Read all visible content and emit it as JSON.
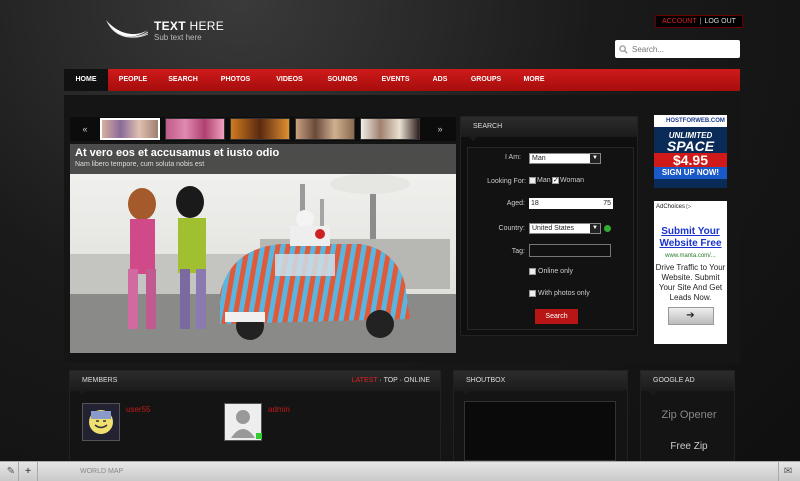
{
  "header": {
    "logo_title_bold": "TEXT",
    "logo_title_rest": "HERE",
    "logo_sub": "Sub text here",
    "account_label": "ACCOUNT",
    "account_sep": "|",
    "logout_label": "LOG OUT",
    "search_placeholder": "Search..."
  },
  "nav": {
    "items": [
      {
        "label": "HOME"
      },
      {
        "label": "PEOPLE"
      },
      {
        "label": "SEARCH"
      },
      {
        "label": "PHOTOS"
      },
      {
        "label": "VIDEOS"
      },
      {
        "label": "SOUNDS"
      },
      {
        "label": "EVENTS"
      },
      {
        "label": "ADS"
      },
      {
        "label": "GROUPS"
      },
      {
        "label": "MORE"
      }
    ],
    "active": "HOME"
  },
  "slider": {
    "prev_icon": "«",
    "next_icon": "»",
    "title": "At vero eos et accusamus et iusto odio",
    "subtitle": "Nam libero tempore, cum soluta nobis est"
  },
  "search": {
    "heading": "SEARCH",
    "i_am_label": "I Am:",
    "i_am_value": "Man",
    "looking_for_label": "Looking For:",
    "looking_man": "Man",
    "looking_woman": "Woman",
    "aged_label": "Aged:",
    "age_from": "18",
    "age_to": "75",
    "country_label": "Country:",
    "country_value": "United States",
    "tag_label": "Tag:",
    "online_only": "Online only",
    "with_photos": "With photos only",
    "button": "Search"
  },
  "ads": {
    "hfw_brand": "HOSTFORWEB.COM",
    "hfw_unlimited": "UNLIMITED",
    "hfw_space": "SPACE",
    "hfw_price": "$4.95",
    "hfw_signup": "SIGN UP NOW!",
    "adchoices": "AdChoices ▷",
    "manta_title": "Submit Your Website Free",
    "manta_url": "www.manta.com/...",
    "manta_desc": "Drive Traffic to Your Website. Submit Your Site And Get Leads Now.",
    "manta_btn": "➔"
  },
  "members": {
    "heading": "MEMBERS",
    "link_latest": "Latest",
    "link_sep": " · ",
    "link_top": "Top",
    "link_online": "Online",
    "list": [
      {
        "name": "user55"
      },
      {
        "name": "admin"
      }
    ]
  },
  "shoutbox": {
    "heading": "SHOUTBOX"
  },
  "google_ad": {
    "heading": "GOOGLE AD",
    "line1": "Zip Opener",
    "line2": "Free Zip"
  },
  "toolbar": {
    "world_map": "WORLD MAP"
  }
}
